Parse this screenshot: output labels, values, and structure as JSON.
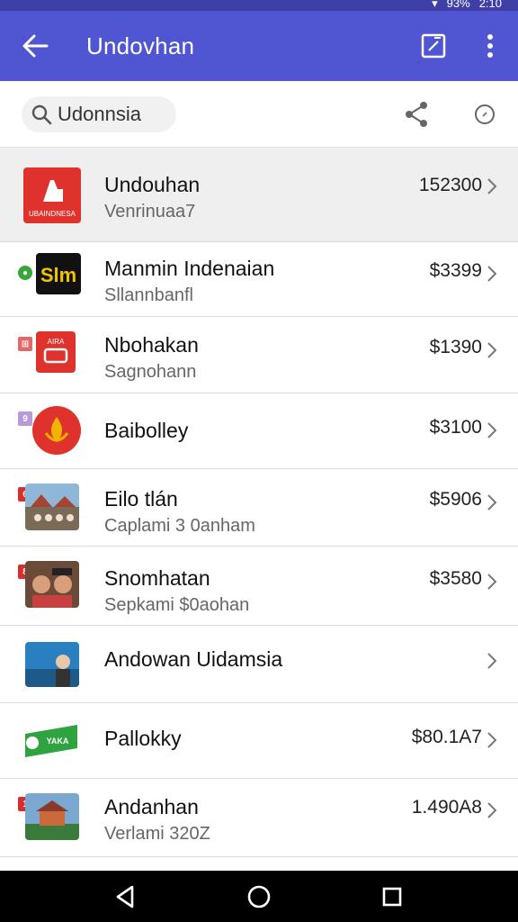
{
  "status_bar": {
    "battery": "93%",
    "time": "2:10"
  },
  "app_bar": {
    "title": "Undovhan"
  },
  "search": {
    "query": "Udonnsia"
  },
  "list": [
    {
      "title": "Undouhan",
      "subtitle": "Venrinuaa7",
      "price": "152300",
      "thumb_label": "UBAINDNESA",
      "selected": true
    },
    {
      "title": "Manmin Indenaian",
      "subtitle": "Sllannbanfl",
      "price": "$3399",
      "thumb_label": "Slm"
    },
    {
      "title": "Nbohakan",
      "subtitle": "Sagnohann",
      "price": "$1390",
      "thumb_label": "AIRA"
    },
    {
      "title": "Baibolley",
      "subtitle": "",
      "price": "$3100"
    },
    {
      "title": "Eilo tlán",
      "subtitle": "Caplami 3 0anham",
      "price": "$5906"
    },
    {
      "title": "Snomhatan",
      "subtitle": "Sepkami $0aohan",
      "price": "$3580"
    },
    {
      "title": "Andowan Uidamsia",
      "subtitle": "",
      "price": ""
    },
    {
      "title": "Pallokky",
      "subtitle": "",
      "price": "$80.1A7",
      "thumb_label": "YAKA"
    },
    {
      "title": "Andanhan",
      "subtitle": "Verlami 320Z",
      "price": "1.490A8"
    }
  ],
  "colors": {
    "app_bar": "#5055d1",
    "status_bar": "#3e3fa8",
    "selected_row": "#efefef",
    "accent_red": "#e0322c"
  },
  "icons": [
    "back-arrow-icon",
    "edit-note-icon",
    "more-vert-icon",
    "search-icon",
    "share-icon",
    "circle-icon",
    "chevron-right-icon",
    "nav-back-icon",
    "nav-home-icon",
    "nav-recents-icon"
  ]
}
